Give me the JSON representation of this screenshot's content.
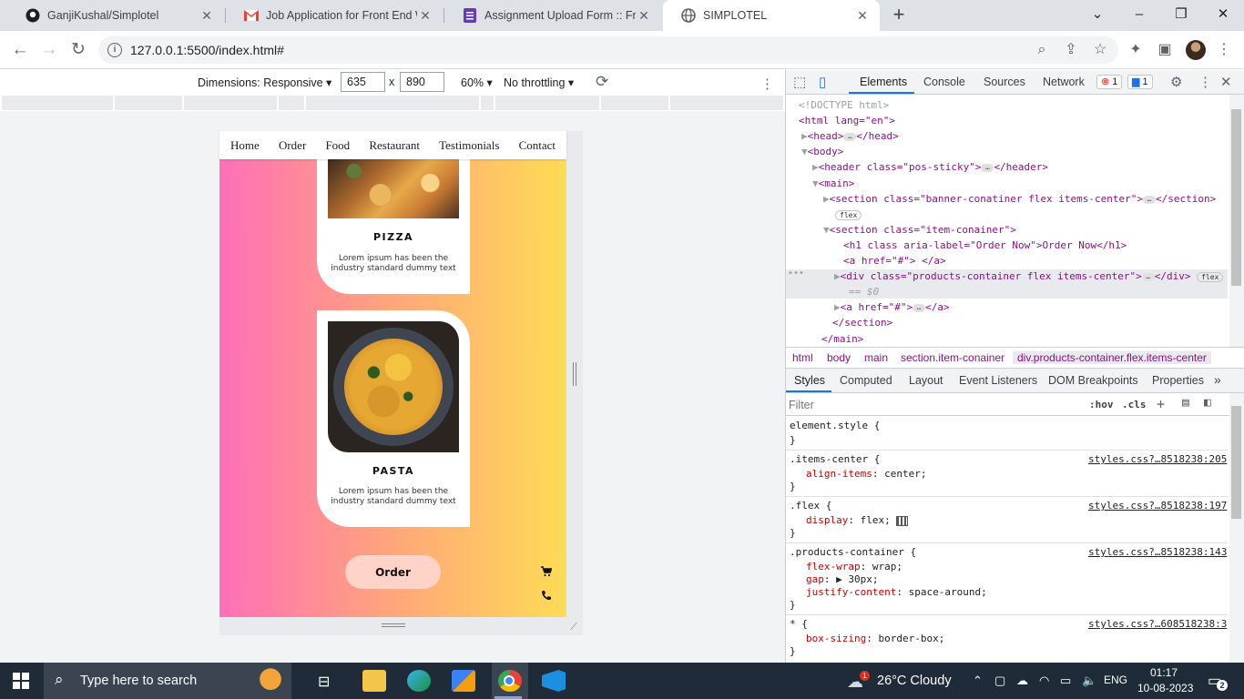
{
  "browser": {
    "tabs": [
      {
        "title": "GanjiKushal/Simplotel",
        "icon": "github-icon"
      },
      {
        "title": "Job Application for Front End We",
        "icon": "gmail-icon"
      },
      {
        "title": "Assignment Upload Form :: Front",
        "icon": "forms-icon"
      },
      {
        "title": "SIMPLOTEL",
        "icon": "globe-icon",
        "active": true
      }
    ],
    "new_tab": "+",
    "url": "127.0.0.1:5500/index.html#"
  },
  "device_toolbar": {
    "dimensions_label": "Dimensions: Responsive",
    "width": "635",
    "times": "x",
    "height": "890",
    "zoom": "60%",
    "throttling": "No throttling"
  },
  "site": {
    "nav": [
      "Home",
      "Order",
      "Food",
      "Restaurant",
      "Testimonials",
      "Contact"
    ],
    "items": [
      {
        "name": "PIZZA",
        "desc": "Lorem ipsum has been the industry standard dummy text"
      },
      {
        "name": "PASTA",
        "desc": "Lorem ipsum has been the industry standard dummy text"
      }
    ],
    "order_button": "Order",
    "cart_icon": "cart-icon",
    "phone_icon": "phone-icon"
  },
  "devtools": {
    "tabs": [
      "Elements",
      "Console",
      "Sources",
      "Network"
    ],
    "errors": "1",
    "messages": "1",
    "dom": {
      "doctype": "<!DOCTYPE html>",
      "html_open": "<html lang=\"en\">",
      "head": "<head>",
      "head_close": "</head>",
      "body": "<body>",
      "header": "<header class=\"pos-sticky\">",
      "header_close": "</header>",
      "main": "<main>",
      "section1": "<section class=\"banner-conatiner flex items-center\">",
      "section_close": "</section>",
      "flex_badge": "flex",
      "section2": "<section class=\"item-conainer\">",
      "h1": "<h1 class aria-label=\"Order Now\">Order Now</h1>",
      "a1": "<a href=\"#\"> </a>",
      "div_sel": "<div class=\"products-container flex items-center\">",
      "div_close": "</div>",
      "eq": "== $0",
      "a2_open": "<a href=\"#\">",
      "a2_close": "</a>",
      "section_end": "</section>",
      "main_end": "</main>"
    },
    "breadcrumbs": [
      "html",
      "body",
      "main",
      "section.item-conainer",
      "div.products-container.flex.items-center"
    ],
    "style_tabs": [
      "Styles",
      "Computed",
      "Layout",
      "Event Listeners",
      "DOM Breakpoints",
      "Properties"
    ],
    "filter_placeholder": "Filter",
    "hov": ":hov",
    "cls": ".cls",
    "rules": [
      {
        "selector": "element.style {",
        "source": "",
        "decls": []
      },
      {
        "selector": ".items-center {",
        "source": "styles.css?…8518238:205",
        "decls": [
          {
            "p": "align-items",
            "v": "center;"
          }
        ]
      },
      {
        "selector": ".flex {",
        "source": "styles.css?…8518238:197",
        "decls": [
          {
            "p": "display",
            "v": "flex;"
          }
        ]
      },
      {
        "selector": ".products-container {",
        "source": "styles.css?…8518238:143",
        "decls": [
          {
            "p": "flex-wrap",
            "v": "wrap;"
          },
          {
            "p": "gap",
            "v": "▶ 30px;"
          },
          {
            "p": "justify-content",
            "v": "space-around;"
          }
        ]
      },
      {
        "selector": "* {",
        "source": "styles.css?…608518238:3",
        "decls": [
          {
            "p": "box-sizing",
            "v": "border-box;"
          }
        ]
      }
    ]
  },
  "taskbar": {
    "search_placeholder": "Type here to search",
    "weather": "26°C  Cloudy",
    "language": "ENG",
    "time": "01:17",
    "date": "10-08-2023",
    "notifications": "2",
    "weather_badge": "1"
  }
}
